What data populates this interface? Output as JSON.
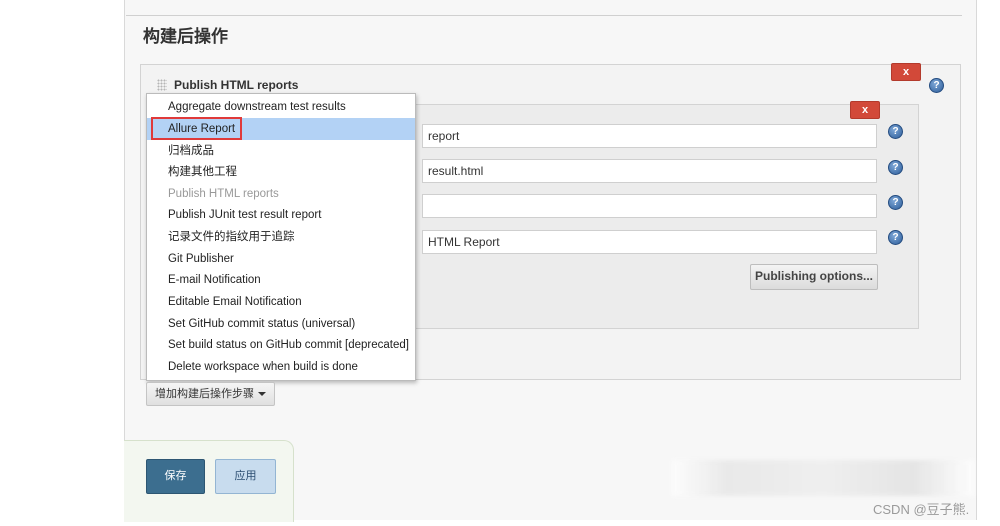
{
  "section_title": "构建后操作",
  "publish_block": {
    "title": "Publish HTML reports",
    "delete_label": "x",
    "inner_delete_label": "x"
  },
  "help_icon_glyph": "?",
  "fields": [
    {
      "value": "report"
    },
    {
      "value": "result.html"
    },
    {
      "value": ""
    },
    {
      "value": "HTML Report"
    }
  ],
  "publishing_options_label": "Publishing options...",
  "dropdown": {
    "items": [
      {
        "label": "Aggregate downstream test results",
        "state": "normal"
      },
      {
        "label": "Allure Report",
        "state": "highlighted"
      },
      {
        "label": "归档成品",
        "state": "normal"
      },
      {
        "label": "构建其他工程",
        "state": "normal"
      },
      {
        "label": "Publish HTML reports",
        "state": "disabled"
      },
      {
        "label": "Publish JUnit test result report",
        "state": "normal"
      },
      {
        "label": "记录文件的指纹用于追踪",
        "state": "normal"
      },
      {
        "label": "Git Publisher",
        "state": "normal"
      },
      {
        "label": "E-mail Notification",
        "state": "normal"
      },
      {
        "label": "Editable Email Notification",
        "state": "normal"
      },
      {
        "label": "Set GitHub commit status (universal)",
        "state": "normal"
      },
      {
        "label": "Set build status on GitHub commit [deprecated]",
        "state": "normal"
      },
      {
        "label": "Delete workspace when build is done",
        "state": "normal"
      }
    ]
  },
  "add_step_label": "增加构建后操作步骤",
  "save_label": "保存",
  "apply_label": "应用",
  "watermark": "CSDN @豆子熊.",
  "colors": {
    "delete_red": "#d24939",
    "highlight_blue": "#b3d2f5",
    "save_blue": "#3c6e8f",
    "annotation_red": "#e03a3a"
  }
}
